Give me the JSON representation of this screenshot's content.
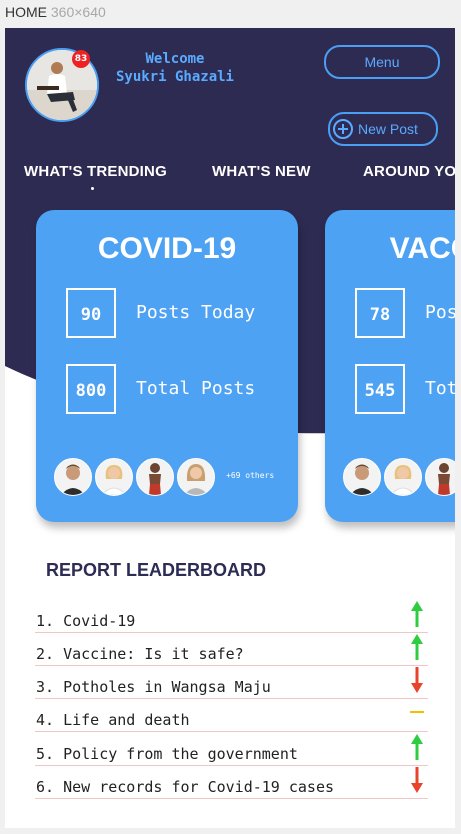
{
  "frame": {
    "name": "HOME",
    "dims": "360×640"
  },
  "header": {
    "welcome_line1": "Welcome",
    "welcome_line2": "Syukri Ghazali",
    "notification_count": "83",
    "menu_label": "Menu",
    "new_post_label": "New Post"
  },
  "tabs": [
    {
      "label": "WHAT'S TRENDING"
    },
    {
      "label": "WHAT'S NEW"
    },
    {
      "label": "AROUND YOU"
    }
  ],
  "cards": [
    {
      "title": "COVID-19",
      "posts_today": "90",
      "posts_today_label": "Posts Today",
      "total_posts": "800",
      "total_posts_label": "Total Posts",
      "others": "+69 others"
    },
    {
      "title": "VACCINE",
      "posts_today": "78",
      "posts_today_label": "Posts Today",
      "total_posts": "545",
      "total_posts_label": "Total Posts"
    }
  ],
  "leaderboard": {
    "title": "REPORT LEADERBOARD",
    "items": [
      {
        "text": "1. Covid-19",
        "trend": "up",
        "icon": "arrow-up-icon"
      },
      {
        "text": "2. Vaccine: Is it safe?",
        "trend": "up",
        "icon": "arrow-up-icon"
      },
      {
        "text": "3. Potholes in Wangsa Maju",
        "trend": "down",
        "icon": "arrow-down-icon"
      },
      {
        "text": "4. Life and death",
        "trend": "same",
        "icon": "dash-icon"
      },
      {
        "text": "5. Policy from the government",
        "trend": "up",
        "icon": "arrow-up-icon"
      },
      {
        "text": "6. New records for Covid-19 cases",
        "trend": "down",
        "icon": "arrow-down-icon"
      }
    ]
  },
  "colors": {
    "header_bg": "#2e2b52",
    "accent_blue": "#4ea2f3",
    "trend_up": "#2ecc40",
    "trend_down": "#e8442a",
    "trend_same": "#f3c000"
  }
}
